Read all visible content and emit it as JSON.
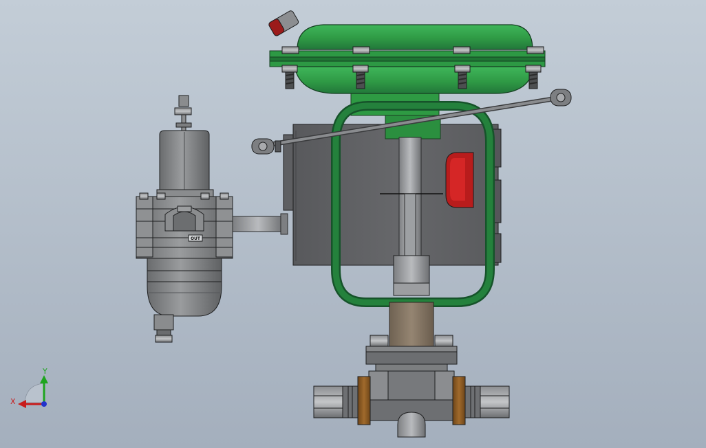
{
  "viewport": {
    "background": {
      "top": "#c3cdd7",
      "bottom": "#a4afbd"
    }
  },
  "model": {
    "regulator_port_label": "OUT",
    "colors": {
      "actuator_green": "#2f9a45",
      "actuator_green_dark": "#1e6b2c",
      "yoke_green": "#1f6f33",
      "positioner_gray": "#5f6164",
      "regulator_gray": "#7a7c7e",
      "indicator_red": "#c41d1d",
      "bonnet_brown": "#8a7a68",
      "flange_bronze": "#8b5a22"
    }
  },
  "triad": {
    "x_label": "X",
    "y_label": "Y",
    "colors": {
      "x": "#c81c1c",
      "y": "#1ea51e",
      "z": "#2233cc"
    }
  }
}
